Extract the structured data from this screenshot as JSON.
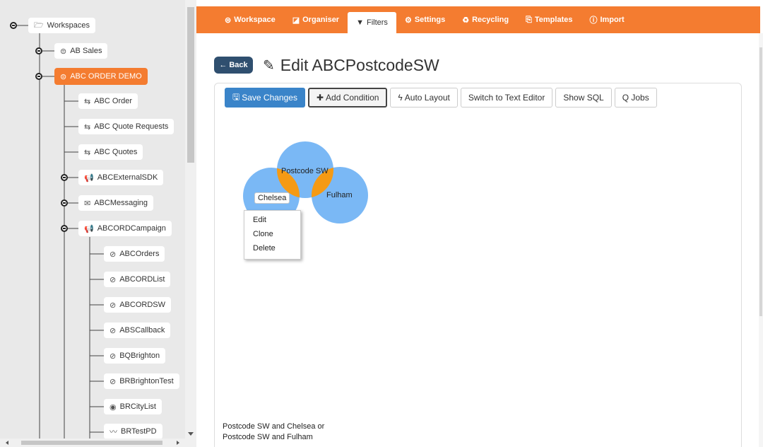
{
  "tree": {
    "nodes": [
      {
        "label": "Workspaces",
        "icon": "folder-open-icon",
        "glyph": "🗁"
      },
      {
        "label": "AB Sales",
        "icon": "database-icon",
        "glyph": "⊜"
      },
      {
        "label": "ABC ORDER DEMO",
        "icon": "database-icon",
        "glyph": "⊜"
      },
      {
        "label": "ABC Order",
        "icon": "arrows-exchange-icon",
        "glyph": "⇆"
      },
      {
        "label": "ABC Quote Requests",
        "icon": "arrows-exchange-icon",
        "glyph": "⇆"
      },
      {
        "label": "ABC Quotes",
        "icon": "arrows-exchange-icon",
        "glyph": "⇆"
      },
      {
        "label": "ABCExternalSDK",
        "icon": "megaphone-icon",
        "glyph": "📢"
      },
      {
        "label": "ABCMessaging",
        "icon": "messaging-icon",
        "glyph": "✉"
      },
      {
        "label": "ABCORDCampaign",
        "icon": "megaphone-icon",
        "glyph": "📢"
      },
      {
        "label": "ABCOrders",
        "icon": "eye-slash-icon",
        "glyph": "⊘"
      },
      {
        "label": "ABCORDList",
        "icon": "eye-slash-icon",
        "glyph": "⊘"
      },
      {
        "label": "ABCORDSW",
        "icon": "eye-slash-icon",
        "glyph": "⊘"
      },
      {
        "label": "ABSCallback",
        "icon": "eye-slash-icon",
        "glyph": "⊘"
      },
      {
        "label": "BQBrighton",
        "icon": "eye-slash-icon",
        "glyph": "⊘"
      },
      {
        "label": "BRBrightonTest",
        "icon": "eye-slash-icon",
        "glyph": "⊘"
      },
      {
        "label": "BRCityList",
        "icon": "eye-icon",
        "glyph": "◉"
      },
      {
        "label": "BRTestPD",
        "icon": "line-chart-icon",
        "glyph": "〰"
      }
    ]
  },
  "nav": {
    "tabs": [
      {
        "label": "Workspace",
        "icon": "database-icon",
        "glyph": "⊜"
      },
      {
        "label": "Organiser",
        "icon": "book-icon",
        "glyph": "◪"
      },
      {
        "label": "Filters",
        "icon": "filter-icon",
        "glyph": "▼"
      },
      {
        "label": "Settings",
        "icon": "gear-icon",
        "glyph": "⚙"
      },
      {
        "label": "Recycling",
        "icon": "recycle-icon",
        "glyph": "♻"
      },
      {
        "label": "Templates",
        "icon": "templates-icon",
        "glyph": "⎘"
      },
      {
        "label": "Import",
        "icon": "info-icon",
        "glyph": "ⓘ"
      }
    ],
    "active": "Filters"
  },
  "header": {
    "back_label": "Back",
    "title": "Edit ABCPostcodeSW"
  },
  "toolbar": {
    "save": "Save Changes",
    "add_condition": "Add Condition",
    "auto_layout": "Auto Layout",
    "text_editor": "Switch to Text Editor",
    "show_sql": "Show SQL",
    "jobs": "Q Jobs"
  },
  "venn": {
    "sets": [
      "Postcode SW",
      "Chelsea",
      "Fulham"
    ],
    "colors": {
      "circle": "#7ab8f5",
      "intersection": "#f59a14"
    }
  },
  "context_menu": {
    "items": [
      "Edit",
      "Clone",
      "Delete"
    ]
  },
  "summary": {
    "line1": "Postcode SW and Chelsea or",
    "line2": "Postcode SW and Fulham"
  },
  "colors": {
    "accent": "#f47c30",
    "back_button": "#2f4f6f",
    "primary_button": "#3a84c9"
  }
}
